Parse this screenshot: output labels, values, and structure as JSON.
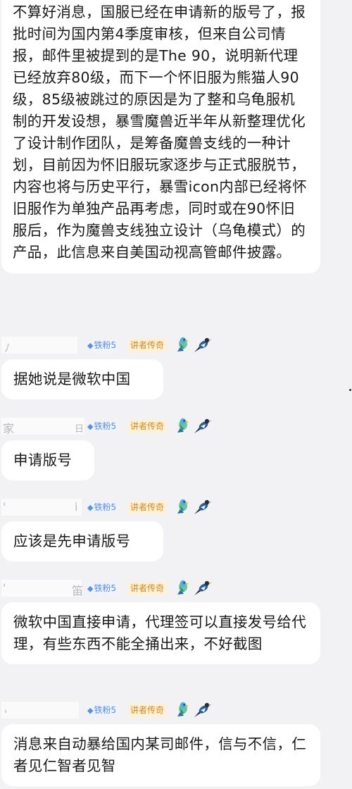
{
  "messages": [
    {
      "text": "不算好消息，国服已经在申请新的版号了，报批时间为国内第4季度审核，但来自公司情报，邮件里被提到的是The 90，说明新代理已经放弃80级，而下一个怀旧服为熊猫人90级，85级被跳过的原因是为了整和乌龟服机制的开发设想，暴雪魔兽近半年从新整理优化了设计制作团队，是筹备魔兽支线的一种计划，目前因为怀旧服玩家逐步与正式服脱节，内容也将与历史平行，暴雪icon内部已经将怀旧服作为单独产品再考虑，同时或在90怀旧服后，作为魔兽支线独立设计（乌龟模式）的产品，此信息来自美国动视高管邮件披露。"
    },
    {
      "sender_partial": [
        "ﾉ"
      ],
      "badge_fan": "铁粉5",
      "badge_lecturer": "讲者传奇",
      "text": "据她说是微软中国"
    },
    {
      "sender_partial": [
        "家",
        "日"
      ],
      "badge_fan": "铁粉5",
      "badge_lecturer": "讲者传奇",
      "text": "申请版号"
    },
    {
      "sender_partial": [
        "'",
        "i"
      ],
      "badge_fan": "铁粉5",
      "badge_lecturer": "讲者传奇",
      "text": "应该是先申请版号"
    },
    {
      "sender_partial": [
        "'",
        "笛"
      ],
      "badge_fan": "铁粉5",
      "badge_lecturer": "讲者传奇",
      "text": "微软中国直接申请，代理签可以直接发号给代理，有些东西不能全捅出来，不好截图"
    },
    {
      "sender_partial": [
        "'"
      ],
      "badge_fan": "铁粉5",
      "badge_lecturer": "讲者传奇",
      "text": "消息来自动暴给国内某司邮件，信与不信，仁者见仁智者见智"
    }
  ],
  "icons": {
    "fan_badge_icon": "diamond-icon",
    "bird_badge_1": "parrot-icon",
    "bird_badge_2": "magpie-icon"
  },
  "colors": {
    "background": "#f2f2f4",
    "bubble": "#ffffff",
    "fan_badge_text": "#5b8ce6",
    "lecturer_badge_text": "#d6891b"
  }
}
